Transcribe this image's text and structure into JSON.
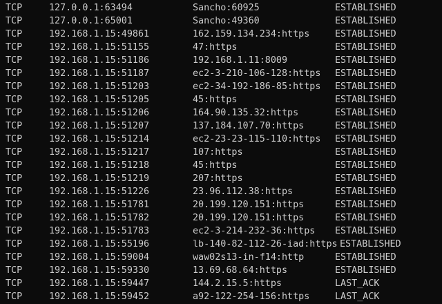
{
  "terminal": {
    "rows": [
      {
        "proto": "TCP",
        "local": "127.0.0.1:63494",
        "foreign": "Sancho:60925",
        "state": "ESTABLISHED"
      },
      {
        "proto": "TCP",
        "local": "127.0.0.1:65001",
        "foreign": "Sancho:49360",
        "state": "ESTABLISHED"
      },
      {
        "proto": "TCP",
        "local": "192.168.1.15:49861",
        "foreign": "162.159.134.234:https",
        "state": "ESTABLISHED"
      },
      {
        "proto": "TCP",
        "local": "192.168.1.15:51155",
        "foreign": "47:https",
        "state": "ESTABLISHED"
      },
      {
        "proto": "TCP",
        "local": "192.168.1.15:51186",
        "foreign": "192.168.1.11:8009",
        "state": "ESTABLISHED"
      },
      {
        "proto": "TCP",
        "local": "192.168.1.15:51187",
        "foreign": "ec2-3-210-106-128:https",
        "state": "ESTABLISHED"
      },
      {
        "proto": "TCP",
        "local": "192.168.1.15:51203",
        "foreign": "ec2-34-192-186-85:https",
        "state": "ESTABLISHED"
      },
      {
        "proto": "TCP",
        "local": "192.168.1.15:51205",
        "foreign": "45:https",
        "state": "ESTABLISHED"
      },
      {
        "proto": "TCP",
        "local": "192.168.1.15:51206",
        "foreign": "164.90.135.32:https",
        "state": "ESTABLISHED"
      },
      {
        "proto": "TCP",
        "local": "192.168.1.15:51207",
        "foreign": "137.184.107.70:https",
        "state": "ESTABLISHED"
      },
      {
        "proto": "TCP",
        "local": "192.168.1.15:51214",
        "foreign": "ec2-23-23-115-110:https",
        "state": "ESTABLISHED"
      },
      {
        "proto": "TCP",
        "local": "192.168.1.15:51217",
        "foreign": "107:https",
        "state": "ESTABLISHED"
      },
      {
        "proto": "TCP",
        "local": "192.168.1.15:51218",
        "foreign": "45:https",
        "state": "ESTABLISHED"
      },
      {
        "proto": "TCP",
        "local": "192.168.1.15:51219",
        "foreign": "207:https",
        "state": "ESTABLISHED"
      },
      {
        "proto": "TCP",
        "local": "192.168.1.15:51226",
        "foreign": "23.96.112.38:https",
        "state": "ESTABLISHED"
      },
      {
        "proto": "TCP",
        "local": "192.168.1.15:51781",
        "foreign": "20.199.120.151:https",
        "state": "ESTABLISHED"
      },
      {
        "proto": "TCP",
        "local": "192.168.1.15:51782",
        "foreign": "20.199.120.151:https",
        "state": "ESTABLISHED"
      },
      {
        "proto": "TCP",
        "local": "192.168.1.15:51783",
        "foreign": "ec2-3-214-232-36:https",
        "state": "ESTABLISHED"
      },
      {
        "proto": "TCP",
        "local": "192.168.1.15:55196",
        "foreign": "lb-140-82-112-26-iad:https",
        "state": "ESTABLISHED"
      },
      {
        "proto": "TCP",
        "local": "192.168.1.15:59004",
        "foreign": "waw02s13-in-f14:http",
        "state": "ESTABLISHED"
      },
      {
        "proto": "TCP",
        "local": "192.168.1.15:59330",
        "foreign": "13.69.68.64:https",
        "state": "ESTABLISHED"
      },
      {
        "proto": "TCP",
        "local": "192.168.1.15:59447",
        "foreign": "144.2.15.5:https",
        "state": "LAST_ACK"
      },
      {
        "proto": "TCP",
        "local": "192.168.1.15:59452",
        "foreign": "a92-122-254-156:https",
        "state": "LAST_ACK"
      }
    ]
  }
}
